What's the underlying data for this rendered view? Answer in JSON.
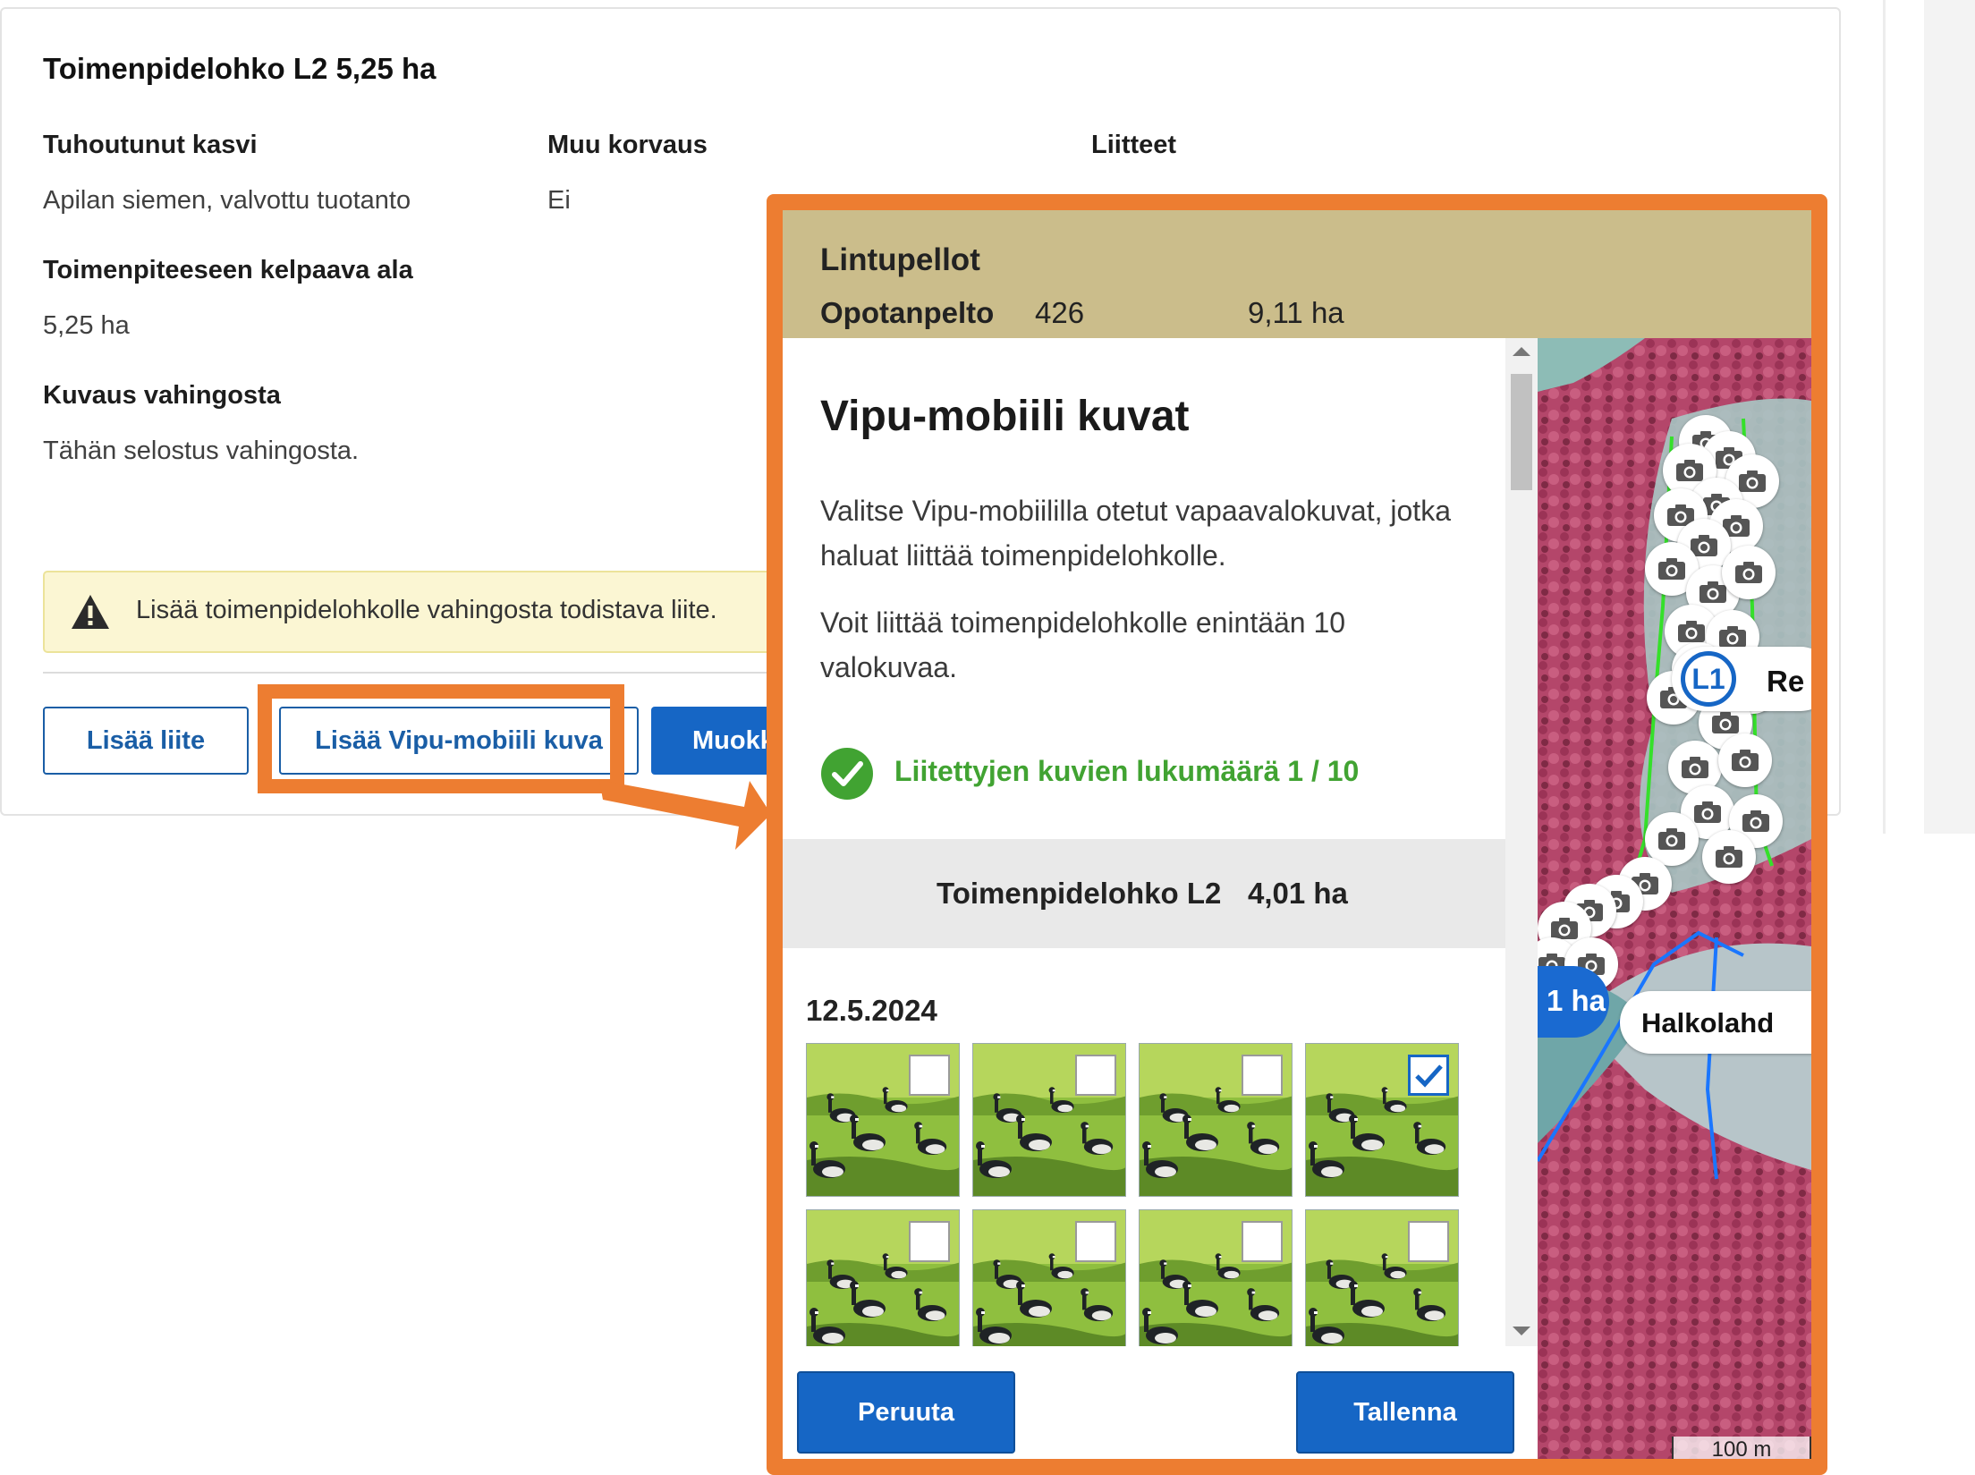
{
  "card": {
    "title": "Toimenpidelohko L2 5,25 ha",
    "crop_label": "Tuhoutunut kasvi",
    "crop_value": "Apilan siemen, valvottu tuotanto",
    "other_comp_label": "Muu korvaus",
    "other_comp_value": "Ei",
    "attachments_label": "Liitteet",
    "eligible_label": "Toimenpiteeseen kelpaava ala",
    "eligible_value": "5,25 ha",
    "damage_label": "Kuvaus vahingosta",
    "damage_value": "Tähän selostus vahingosta.",
    "alert_text": "Lisää toimenpidelohkolle vahingosta todistava liite.",
    "btn_add_attachment": "Lisää liite",
    "btn_add_vipu": "Lisää Vipu-mobiili kuva",
    "btn_edit": "Muokkaa"
  },
  "modal": {
    "header_title": "Lintupellot",
    "header_name": "Opotanpelto",
    "header_number": "426",
    "header_area": "9,11 ha",
    "title": "Vipu-mobiili kuvat",
    "para1": "Valitse Vipu-mobiililla otetut vapaavalokuvat, jotka haluat liittää toimenpidelohkolle.",
    "para2": "Voit liittää toimenpidelohkolle enintään 10 valokuvaa.",
    "count_text": "Liitettyjen kuvien lukumäärä 1 / 10",
    "block_name": "Toimenpidelohko L2",
    "block_area": "4,01 ha",
    "photo_date": "12.5.2024",
    "photos": [
      {
        "checked": false
      },
      {
        "checked": false
      },
      {
        "checked": false
      },
      {
        "checked": true
      },
      {
        "checked": false
      },
      {
        "checked": false
      },
      {
        "checked": false
      },
      {
        "checked": false
      }
    ],
    "cancel_label": "Peruuta",
    "save_label": "Tallenna"
  },
  "map": {
    "label_l1": "L1",
    "label_re": "Re",
    "label_ha": "1 ha",
    "label_halko": "Halkolahd",
    "scale": "100 m"
  },
  "colors": {
    "highlight": "#ed7d31",
    "primary": "#1666c5",
    "success": "#41a332",
    "header_bg": "#cbbd8b",
    "alert_bg": "#fbf6d3"
  },
  "icons": [
    "warning-icon",
    "check-circle-icon",
    "camera-icon",
    "checkbox-check-icon"
  ]
}
